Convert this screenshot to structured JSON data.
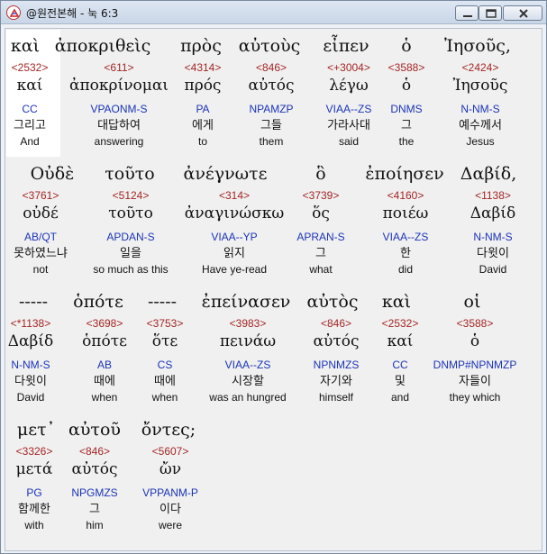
{
  "window": {
    "title": "@원전본해 - 눅 6:3"
  },
  "rows": [
    {
      "greek": [
        "καὶ",
        "ἀποκριθεὶς",
        "πρὸς",
        "αὐτοὺς",
        "εἶπεν",
        "ὁ",
        "Ἰησοῦς,"
      ],
      "words": [
        {
          "strong": "<2532>",
          "lemma": "καί",
          "parse": "CC",
          "korean": "그리고",
          "english": "And"
        },
        {
          "strong": "<611>",
          "lemma": "ἀποκρίνομαι",
          "parse": "VPAONM-S",
          "korean": "대답하여",
          "english": "answering"
        },
        {
          "strong": "<4314>",
          "lemma": "πρός",
          "parse": "PA",
          "korean": "에게",
          "english": "to"
        },
        {
          "strong": "<846>",
          "lemma": "αὐτός",
          "parse": "NPAMZP",
          "korean": "그들",
          "english": "them"
        },
        {
          "strong": "<+3004>",
          "lemma": "λέγω",
          "parse": "VIAA--ZS",
          "korean": "가라사대",
          "english": "said"
        },
        {
          "strong": "<3588>",
          "lemma": "ὁ",
          "parse": "DNMS",
          "korean": "그",
          "english": "the"
        },
        {
          "strong": "<2424>",
          "lemma": "Ἰησοῦς",
          "parse": "N-NM-S",
          "korean": "예수께서",
          "english": "Jesus"
        }
      ]
    },
    {
      "greek": [
        "Οὐδὲ",
        "τοῦτο",
        "ἀνέγνωτε",
        "ὃ",
        "ἐποίησεν",
        "Δαβίδ,"
      ],
      "words": [
        {
          "strong": "<3761>",
          "lemma": "οὐδέ",
          "parse": "AB/QT",
          "korean": "못하였느냐",
          "english": "not"
        },
        {
          "strong": "<5124>",
          "lemma": "τοῦτο",
          "parse": "APDAN-S",
          "korean": "일을",
          "english": "so much as this"
        },
        {
          "strong": "<314>",
          "lemma": "ἀναγινώσκω",
          "parse": "VIAA--YP",
          "korean": "읽지",
          "english": "Have ye-read"
        },
        {
          "strong": "<3739>",
          "lemma": "ὅς",
          "parse": "APRAN-S",
          "korean": "그",
          "english": "what"
        },
        {
          "strong": "<4160>",
          "lemma": "ποιέω",
          "parse": "VIAA--ZS",
          "korean": "한",
          "english": "did"
        },
        {
          "strong": "<1138>",
          "lemma": "Δαβίδ",
          "parse": "N-NM-S",
          "korean": "다윗이",
          "english": "David"
        }
      ]
    },
    {
      "greek": [
        "-----",
        "ὁπότε",
        "-----",
        "ἐπείνασεν",
        "αὐτὸς",
        "καὶ",
        "οἱ"
      ],
      "words": [
        {
          "strong": "<*1138>",
          "lemma": "Δαβίδ",
          "parse": "N-NM-S",
          "korean": "다윗이",
          "english": "David"
        },
        {
          "strong": "<3698>",
          "lemma": "ὁπότε",
          "parse": "AB",
          "korean": "때에",
          "english": "when"
        },
        {
          "strong": "<3753>",
          "lemma": "ὅτε",
          "parse": "CS",
          "korean": "때에",
          "english": "when"
        },
        {
          "strong": "<3983>",
          "lemma": "πεινάω",
          "parse": "VIAA--ZS",
          "korean": "시장할",
          "english": "was an hungred"
        },
        {
          "strong": "<846>",
          "lemma": "αὐτός",
          "parse": "NPNMZS",
          "korean": "자기와",
          "english": "himself"
        },
        {
          "strong": "<2532>",
          "lemma": "καί",
          "parse": "CC",
          "korean": "및",
          "english": "and"
        },
        {
          "strong": "<3588>",
          "lemma": "ὁ",
          "parse": "DNMP#NPNMZP",
          "korean": "자들이",
          "english": "they which"
        }
      ]
    },
    {
      "greek": [
        "μετ᾿",
        "αὐτοῦ",
        "ὄντες;"
      ],
      "words": [
        {
          "strong": "<3326>",
          "lemma": "μετά",
          "parse": "PG",
          "korean": "함께한",
          "english": "with"
        },
        {
          "strong": "<846>",
          "lemma": "αὐτός",
          "parse": "NPGMZS",
          "korean": "그",
          "english": "him"
        },
        {
          "strong": "<5607>",
          "lemma": "ὤν",
          "parse": "VPPANM-P",
          "korean": "이다",
          "english": "were"
        }
      ]
    }
  ]
}
